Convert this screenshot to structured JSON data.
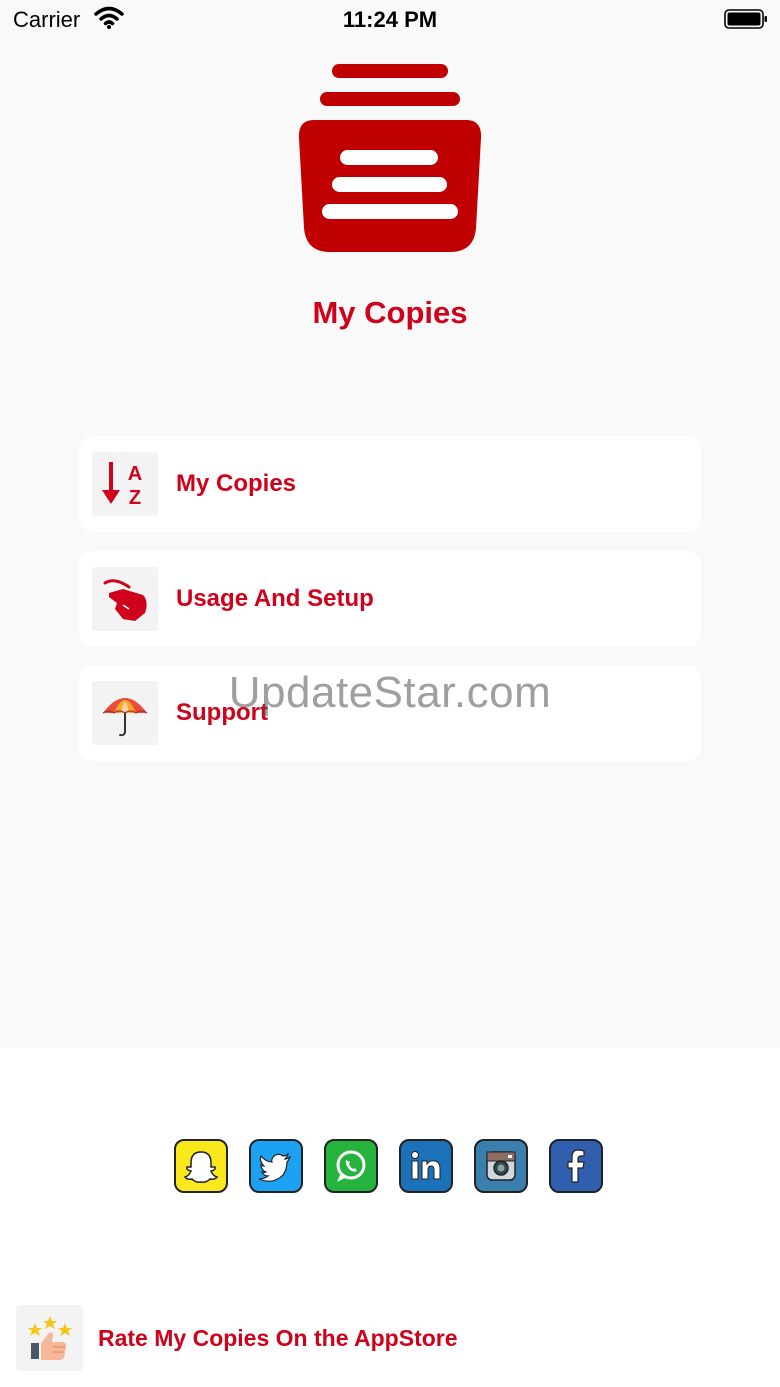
{
  "status_bar": {
    "carrier": "Carrier",
    "time": "11:24 PM"
  },
  "app": {
    "title": "My Copies",
    "brand_color": "#d0021b"
  },
  "menu": [
    {
      "label": "My Copies",
      "icon": "sort-az-icon"
    },
    {
      "label": "Usage And Setup",
      "icon": "hand-tap-icon"
    },
    {
      "label": "Support",
      "icon": "umbrella-icon"
    }
  ],
  "watermark": "UpdateStar.com",
  "socials": [
    {
      "name": "Snapchat",
      "icon": "snapchat-icon",
      "color": "#f8e81c"
    },
    {
      "name": "Twitter",
      "icon": "twitter-icon",
      "color": "#1da1f2"
    },
    {
      "name": "WhatsApp",
      "icon": "whatsapp-icon",
      "color": "#25b33e"
    },
    {
      "name": "LinkedIn",
      "icon": "linkedin-icon",
      "color": "#1b72b8"
    },
    {
      "name": "Instagram",
      "icon": "instagram-icon",
      "color": "#3b7fae"
    },
    {
      "name": "Facebook",
      "icon": "facebook-icon",
      "color": "#2f5fae"
    }
  ],
  "rate": {
    "label": "Rate My Copies On the AppStore",
    "icon": "rate-stars-thumb-icon"
  }
}
